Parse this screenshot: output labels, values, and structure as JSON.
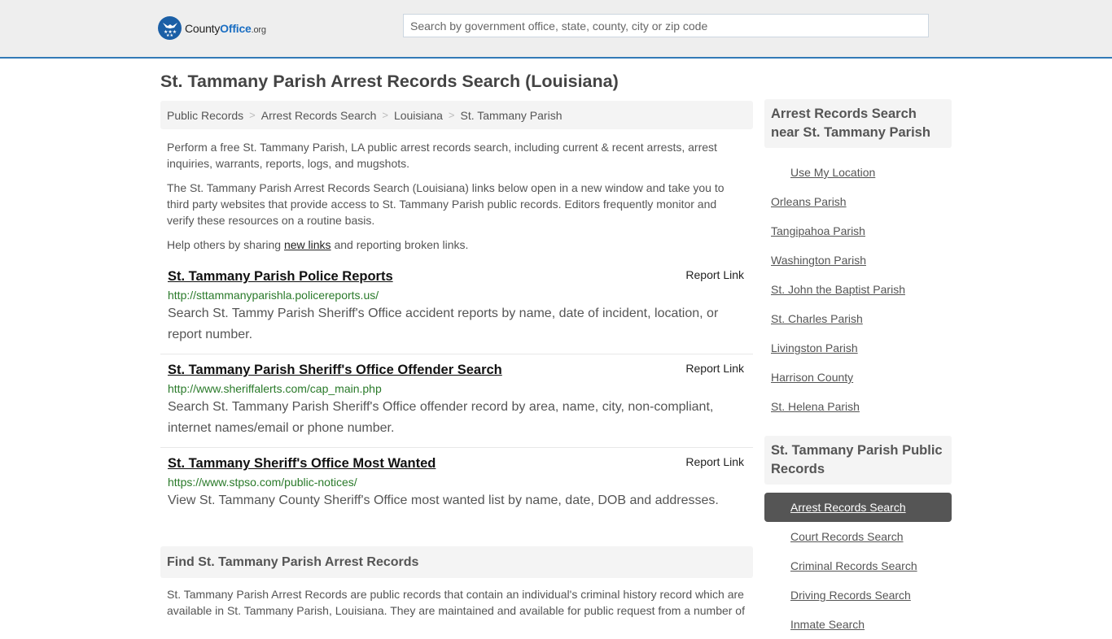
{
  "header": {
    "logo": {
      "brand_a": "County",
      "brand_b": "Office",
      "brand_c": ".org",
      "icon": "eagle-stars-icon"
    },
    "search": {
      "placeholder": "Search by government office, state, county, city or zip code",
      "value": ""
    }
  },
  "page_title": "St. Tammany Parish Arrest Records Search (Louisiana)",
  "breadcrumb": [
    {
      "label": "Public Records"
    },
    {
      "label": "Arrest Records Search"
    },
    {
      "label": "Louisiana"
    },
    {
      "label": "St. Tammany Parish"
    }
  ],
  "breadcrumb_separator": ">",
  "intro": {
    "p1": "Perform a free St. Tammany Parish, LA public arrest records search, including current & recent arrests, arrest inquiries, warrants, reports, logs, and mugshots.",
    "p2": "The St. Tammany Parish Arrest Records Search (Louisiana) links below open in a new window and take you to third party websites that provide access to St. Tammany Parish public records. Editors frequently monitor and verify these resources on a routine basis.",
    "p3_before": "Help others by sharing ",
    "p3_link": "new links",
    "p3_after": " and reporting broken links."
  },
  "results": [
    {
      "title": "St. Tammany Parish Police Reports",
      "url": "http://sttammanyparishla.policereports.us/",
      "description": "Search St. Tammy Parish Sheriff's Office accident reports by name, date of incident, location, or report number.",
      "report_label": "Report Link"
    },
    {
      "title": "St. Tammany Parish Sheriff's Office Offender Search",
      "url": "http://www.sheriffalerts.com/cap_main.php",
      "description": "Search St. Tammany Parish Sheriff's Office offender record by area, name, city, non-compliant, internet names/email or phone number.",
      "report_label": "Report Link"
    },
    {
      "title": "St. Tammany Sheriff's Office Most Wanted",
      "url": "https://www.stpso.com/public-notices/",
      "description": "View St. Tammany County Sheriff's Office most wanted list by name, date, DOB and addresses.",
      "report_label": "Report Link"
    }
  ],
  "find_section": {
    "heading": "Find St. Tammany Parish Arrest Records",
    "body": "St. Tammany Parish Arrest Records are public records that contain an individual's criminal history record which are available in St. Tammany Parish, Louisiana. They are maintained and available for public request from a number of"
  },
  "sidebar": {
    "nearby": {
      "heading": "Arrest Records Search near St. Tammany Parish",
      "use_location": "Use My Location",
      "items": [
        "Orleans Parish",
        "Tangipahoa Parish",
        "Washington Parish",
        "St. John the Baptist Parish",
        "St. Charles Parish",
        "Livingston Parish",
        "Harrison County",
        "St. Helena Parish"
      ]
    },
    "public_records": {
      "heading": "St. Tammany Parish Public Records",
      "active_index": 0,
      "items": [
        "Arrest Records Search",
        "Court Records Search",
        "Criminal Records Search",
        "Driving Records Search",
        "Inmate Search"
      ]
    }
  },
  "colors": {
    "header_bg": "#eeeeee",
    "header_border": "#337ab7",
    "brand_blue": "#1b6ec2",
    "url_green": "#2a7a2a",
    "active_bg": "#555555"
  }
}
